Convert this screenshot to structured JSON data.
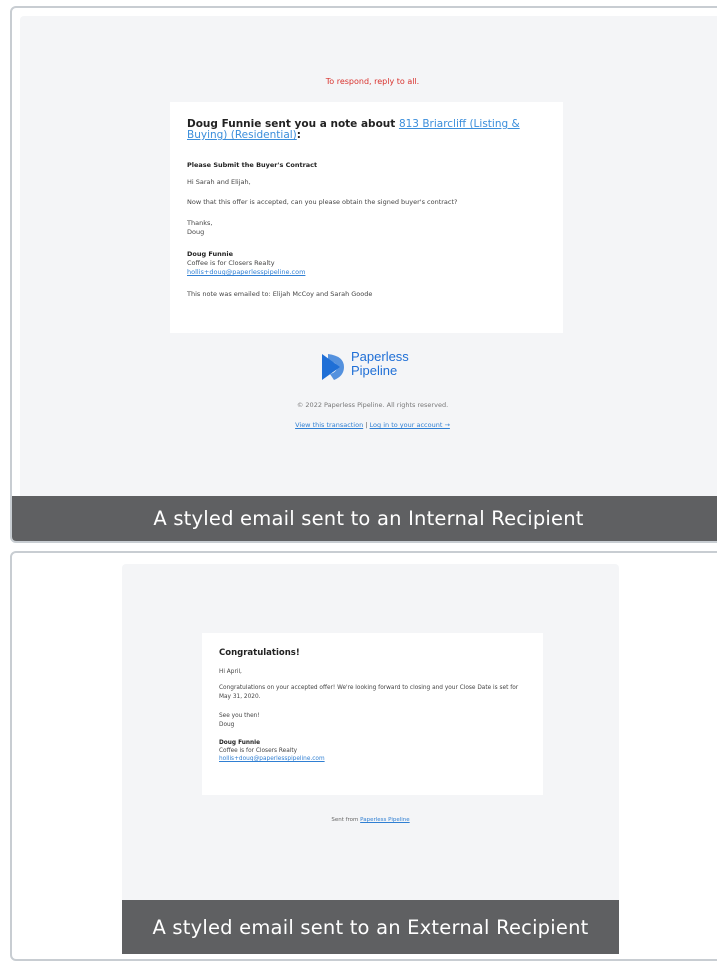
{
  "internal": {
    "respond_note": "To respond, reply to all.",
    "heading_prefix": "Doug Funnie sent you a note about ",
    "heading_link": "813 Briarcliff (Listing & Buying) (Residential)",
    "heading_suffix": ":",
    "subject": "Please Submit the Buyer's Contract",
    "greeting": "Hi Sarah and Elijah,",
    "body": "Now that this offer is accepted, can you please obtain the signed buyer's contract?",
    "signoff_1": "Thanks,",
    "signoff_2": "Doug",
    "sender_name": "Doug Funnie",
    "sender_company": "Coffee is for Closers Realty",
    "sender_email": "hollis+doug@paperlesspipeline.com",
    "emailed_to": "This note was emailed to: Elijah McCoy and Sarah Goode",
    "logo_line1": "Paperless",
    "logo_line2": "Pipeline",
    "copyright": "© 2022 Paperless Pipeline. All rights reserved.",
    "link_transaction": "View this transaction",
    "link_separator": " | ",
    "link_login": "Log in to your account →",
    "caption": "A styled email sent to an Internal Recipient"
  },
  "external": {
    "title": "Congratulations!",
    "greeting": "Hi April,",
    "body": "Congratulations on your accepted offer! We're looking forward to closing and your Close Date is set for May 31, 2020.",
    "signoff_1": "See you then!",
    "signoff_2": "Doug",
    "sender_name": "Doug Funnie",
    "sender_company": "Coffee is for Closers Realty",
    "sender_email": "hollis+doug@paperlesspipeline.com",
    "sent_from_prefix": "Sent from ",
    "sent_from_link": "Paperless Pipeline",
    "caption": "A styled email sent to an External Recipient"
  },
  "colors": {
    "accent_red": "#d9332e",
    "link_blue": "#3b8edb",
    "logo_blue": "#1f6fd6",
    "caption_bg": "#5f6062"
  }
}
